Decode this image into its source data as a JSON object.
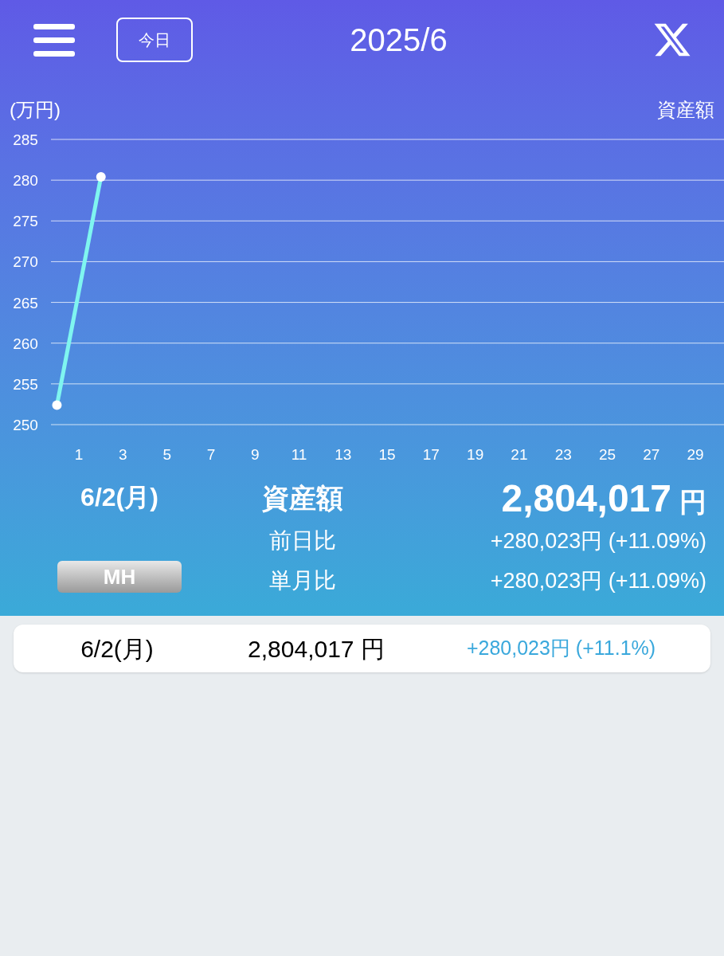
{
  "header": {
    "today_button": "今日",
    "title": "2025/6"
  },
  "chart": {
    "unit_label": "(万円)",
    "chart_data": {
      "type": "line",
      "grid": true,
      "x": [
        0,
        2
      ],
      "series": [
        {
          "name": "資産額",
          "color": "#7ff5f0",
          "marker": "circle",
          "values": [
            252.4,
            280.4
          ]
        }
      ],
      "xlim": [
        -0.27,
        30.3
      ],
      "ylim": [
        250,
        285
      ],
      "xticks": [
        1,
        3,
        5,
        7,
        9,
        11,
        13,
        15,
        17,
        19,
        21,
        23,
        25,
        27,
        29
      ],
      "yticks": [
        250,
        255,
        260,
        265,
        270,
        275,
        280,
        285
      ]
    }
  },
  "summary": {
    "date": "6/2(月)",
    "badge": "MH",
    "label": "資産額",
    "amount": "2,804,017",
    "currency": "円",
    "rows": [
      {
        "label": "前日比",
        "value": "+280,023円 (+11.09%)"
      },
      {
        "label": "単月比",
        "value": "+280,023円 (+11.09%)"
      }
    ]
  },
  "list": [
    {
      "date": "6/2(月)",
      "amount": "2,804,017 円",
      "change": "+280,023円 (+11.1%)"
    }
  ]
}
